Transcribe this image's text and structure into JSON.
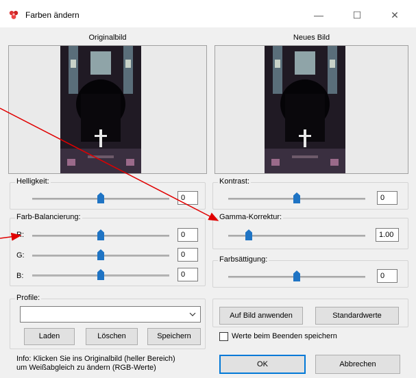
{
  "window": {
    "title": "Farben ändern",
    "minimize_glyph": "—",
    "maximize_glyph": "☐",
    "close_glyph": "✕"
  },
  "panels": {
    "original_label": "Originalbild",
    "new_label": "Neues Bild"
  },
  "helligkeit": {
    "label": "Helligkeit:",
    "value": "0",
    "level": 0.5
  },
  "kontrast": {
    "label": "Kontrast:",
    "value": "0",
    "level": 0.5
  },
  "balance": {
    "label": "Farb-Balancierung:",
    "r": {
      "label": "R:",
      "value": "0",
      "level": 0.5
    },
    "g": {
      "label": "G:",
      "value": "0",
      "level": 0.5
    },
    "b": {
      "label": "B:",
      "value": "0",
      "level": 0.5
    }
  },
  "gamma": {
    "label": "Gamma-Korrektur:",
    "value": "1.00",
    "level": 0.15
  },
  "saettigung": {
    "label": "Farbsättigung:",
    "value": "0",
    "level": 0.5
  },
  "profile": {
    "label": "Profile:",
    "selected": "",
    "laden": "Laden",
    "loeschen": "Löschen",
    "speichern": "Speichern"
  },
  "actions": {
    "apply": "Auf Bild anwenden",
    "defaults": "Standardwerte",
    "save_on_exit": "Werte beim Beenden speichern",
    "save_on_exit_checked": false,
    "ok": "OK",
    "cancel": "Abbrechen"
  },
  "info": {
    "line1": "Info: Klicken Sie ins Originalbild (heller Bereich)",
    "line2": "um Weißabgleich zu ändern (RGB-Werte)"
  },
  "colors": {
    "accent": "#1f74c4",
    "arrow": "#e00000"
  }
}
